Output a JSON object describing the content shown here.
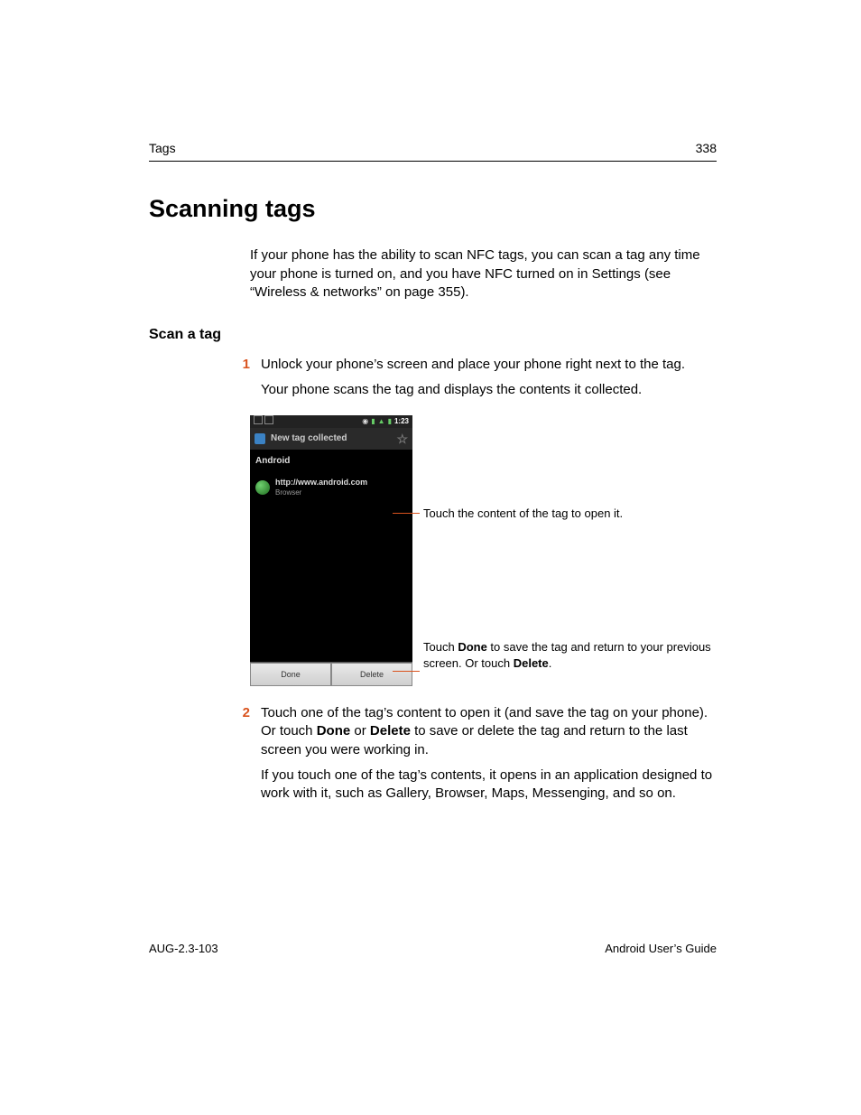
{
  "header": {
    "section": "Tags",
    "page_number": "338"
  },
  "headings": {
    "h1": "Scanning tags",
    "h2": "Scan a tag"
  },
  "intro": "If your phone has the ability to scan NFC tags, you can scan a tag any time your phone is turned on, and you have NFC turned on in Settings (see “Wireless & networks” on page 355).",
  "steps": {
    "one": {
      "num": "1",
      "line1": "Unlock your phone’s screen and place your phone right next to the tag.",
      "line2": "Your phone scans the tag and displays the contents it collected."
    },
    "two": {
      "num": "2",
      "pre": "Touch one of the tag’s content to open it (and save the tag on your phone). Or touch ",
      "bold1": "Done",
      "mid": " or ",
      "bold2": "Delete",
      "post": " to save or delete the tag and return to the last screen you were working in.",
      "para2": "If you touch one of the tag’s contents, it opens in an application designed to work with it, such as Gallery, Browser, Maps, Messenging, and so on."
    }
  },
  "screenshot": {
    "clock": "1:23",
    "titlebar": "New tag collected",
    "section_label": "Android",
    "url": "http://www.android.com",
    "url_sub": "Browser",
    "btn_done": "Done",
    "btn_delete": "Delete"
  },
  "callouts": {
    "top": "Touch the content of the tag to open it.",
    "bottom_pre": "Touch ",
    "bottom_b1": "Done",
    "bottom_mid": " to save the tag and return to your previous screen. Or touch ",
    "bottom_b2": "Delete",
    "bottom_post": "."
  },
  "footer": {
    "left": "AUG-2.3-103",
    "right": "Android User’s Guide"
  }
}
